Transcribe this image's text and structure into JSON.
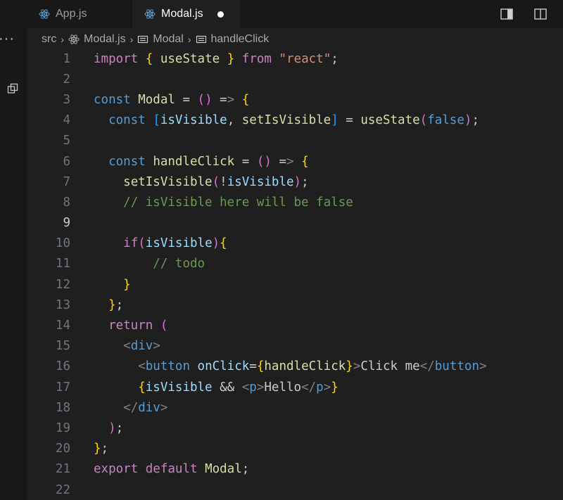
{
  "tabs": [
    {
      "label": "App.js",
      "icon": "react-icon"
    },
    {
      "label": "Modal.js",
      "icon": "react-icon",
      "dirty": true
    }
  ],
  "breadcrumb": {
    "folder": "src",
    "file": "Modal.js",
    "symbol1": "Modal",
    "symbol2": "handleClick"
  },
  "editor": {
    "language": "javascript",
    "current_line": 9,
    "line_numbers": [
      "1",
      "2",
      "3",
      "4",
      "5",
      "6",
      "7",
      "8",
      "9",
      "10",
      "11",
      "12",
      "13",
      "14",
      "15",
      "16",
      "17",
      "18",
      "19",
      "20",
      "21",
      "22"
    ],
    "lines": [
      "import { useState } from \"react\";",
      "",
      "const Modal = () => {",
      "  const [isVisible, setIsVisible] = useState(false);",
      "",
      "  const handleClick = () => {",
      "    setIsVisible(!isVisible);",
      "    // isVisible here will be false",
      "",
      "    if(isVisible){",
      "        // todo",
      "    }",
      "  };",
      "  return (",
      "    <div>",
      "      <button onClick={handleClick}>Click me</button>",
      "      {isVisible && <p>Hello</p>}",
      "    </div>",
      "  );",
      "};",
      "export default Modal;",
      ""
    ]
  },
  "colors": {
    "editor_bg": "#1f1f1f",
    "tabbar_bg": "#181818",
    "keyword": "#c586c0",
    "declaration": "#569cd6",
    "function": "#dcdcaa",
    "variable": "#9cdcfe",
    "string": "#ce9178"
  }
}
